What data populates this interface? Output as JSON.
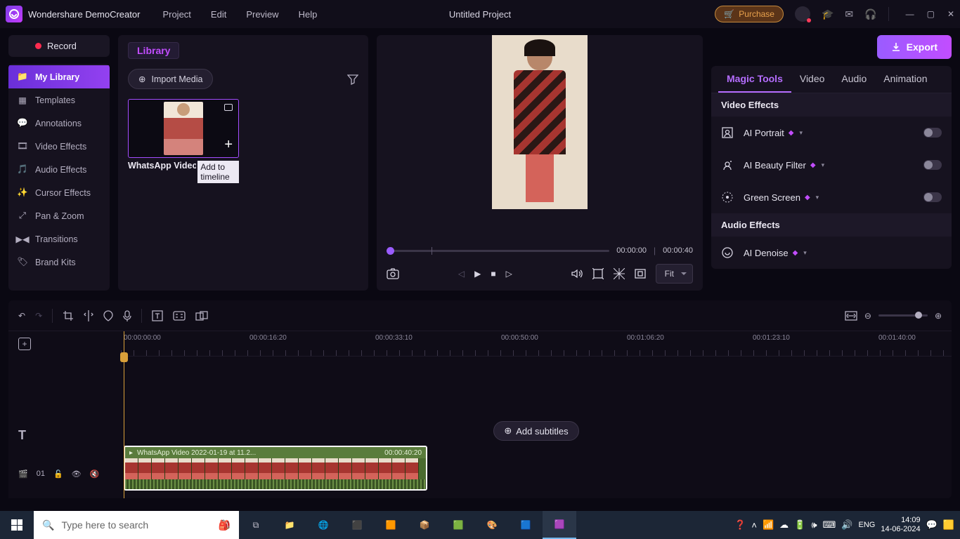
{
  "app": {
    "name": "Wondershare DemoCreator",
    "project_title": "Untitled Project"
  },
  "menu": {
    "project": "Project",
    "edit": "Edit",
    "preview": "Preview",
    "help": "Help"
  },
  "title_actions": {
    "purchase": "Purchase"
  },
  "record": {
    "label": "Record"
  },
  "export": {
    "label": "Export"
  },
  "sidebar": {
    "items": [
      {
        "label": "My Library"
      },
      {
        "label": "Templates"
      },
      {
        "label": "Annotations"
      },
      {
        "label": "Video Effects"
      },
      {
        "label": "Audio Effects"
      },
      {
        "label": "Cursor Effects"
      },
      {
        "label": "Pan & Zoom"
      },
      {
        "label": "Transitions"
      },
      {
        "label": "Brand Kits"
      }
    ]
  },
  "library": {
    "tab": "Library",
    "import": "Import Media",
    "clip_name": "WhatsApp Video 2022-01-",
    "tooltip": "Add to timeline"
  },
  "preview": {
    "current": "00:00:00",
    "duration": "00:00:40",
    "fit": "Fit"
  },
  "right_panel": {
    "tabs": {
      "magic": "Magic Tools",
      "video": "Video",
      "audio": "Audio",
      "animation": "Animation"
    },
    "section_video": "Video Effects",
    "section_audio": "Audio Effects",
    "rows": {
      "portrait": "AI Portrait",
      "beauty": "AI Beauty Filter",
      "green": "Green Screen",
      "denoise": "AI Denoise"
    }
  },
  "timeline": {
    "ruler": [
      "00:00:00:00",
      "00:00:16:20",
      "00:00:33:10",
      "00:00:50:00",
      "00:01:06:20",
      "00:01:23:10",
      "00:01:40:00"
    ],
    "add_subtitles": "Add subtitles",
    "clip": {
      "name": "WhatsApp Video 2022-01-19 at 11.2...",
      "duration": "00:00:40:20"
    },
    "track_count": "01"
  },
  "taskbar": {
    "search_placeholder": "Type here to search",
    "lang": "ENG",
    "time": "14:09",
    "date": "14-06-2024"
  }
}
